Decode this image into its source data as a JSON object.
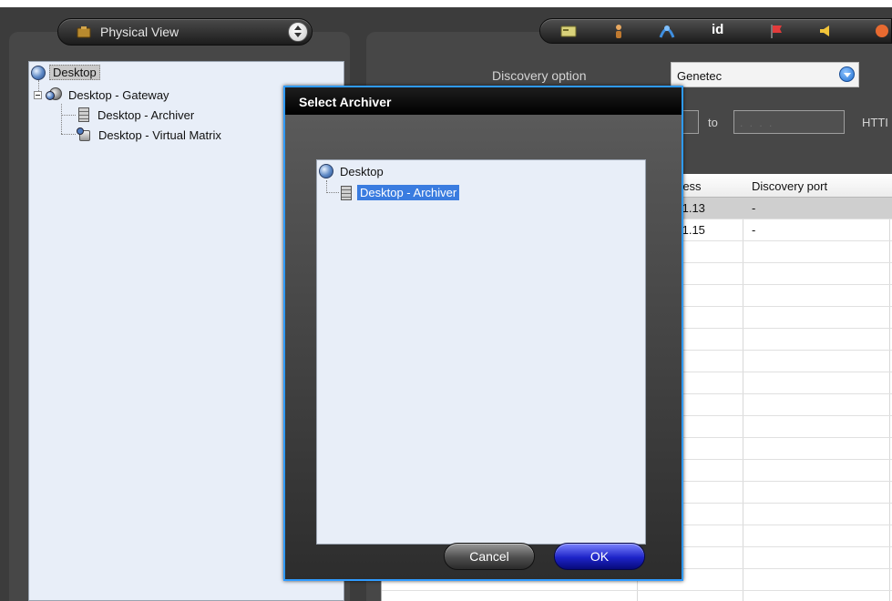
{
  "view_selector": {
    "label": "Physical View"
  },
  "toolbar": {
    "buttons": [
      {
        "name": "card-icon",
        "color": "#d9d27a"
      },
      {
        "name": "user-icon",
        "color": "#e8a860"
      },
      {
        "name": "network-icon",
        "color": "#3f8fe0"
      },
      {
        "name": "id-icon",
        "label": "id"
      },
      {
        "name": "flag-icon",
        "color": "#e23b3b"
      },
      {
        "name": "speaker-icon",
        "color": "#f2c53a"
      },
      {
        "name": "alarm-icon",
        "color": "#e86a30"
      }
    ]
  },
  "left_tree": {
    "root": "Desktop",
    "gateway": "Desktop - Gateway",
    "archiver": "Desktop - Archiver",
    "matrix": "Desktop - Virtual Matrix"
  },
  "discovery": {
    "label": "Discovery option",
    "value": "Genetec",
    "to_label": "to",
    "ip_to_placeholder": ". . . .",
    "http_label": "HTTI"
  },
  "grid": {
    "columns": [
      "ress",
      "Discovery port"
    ],
    "rows": [
      {
        "address": ".1.13",
        "port": "-"
      },
      {
        "address": ".1.15",
        "port": "-"
      }
    ]
  },
  "dialog": {
    "title": "Select Archiver",
    "tree_root": "Desktop",
    "tree_item": "Desktop - Archiver",
    "cancel_label": "Cancel",
    "ok_label": "OK",
    "border_color": "#2f9bff"
  }
}
